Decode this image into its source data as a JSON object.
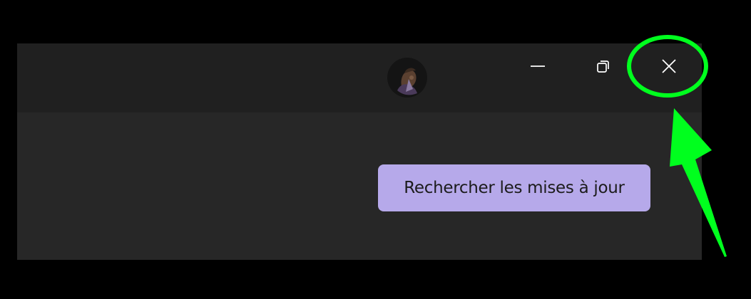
{
  "window": {
    "background": "#272727",
    "titlebar_background": "#202020"
  },
  "titlebar": {
    "avatar_icon": "user-avatar",
    "minimize_icon": "minimize-icon",
    "restore_icon": "restore-icon",
    "close_icon": "close-icon"
  },
  "content": {
    "check_updates_label": "Rechercher les mises à jour",
    "accent_color": "#b6a9ea"
  },
  "annotation": {
    "highlight_color": "#00ff1e",
    "target": "close-button"
  }
}
